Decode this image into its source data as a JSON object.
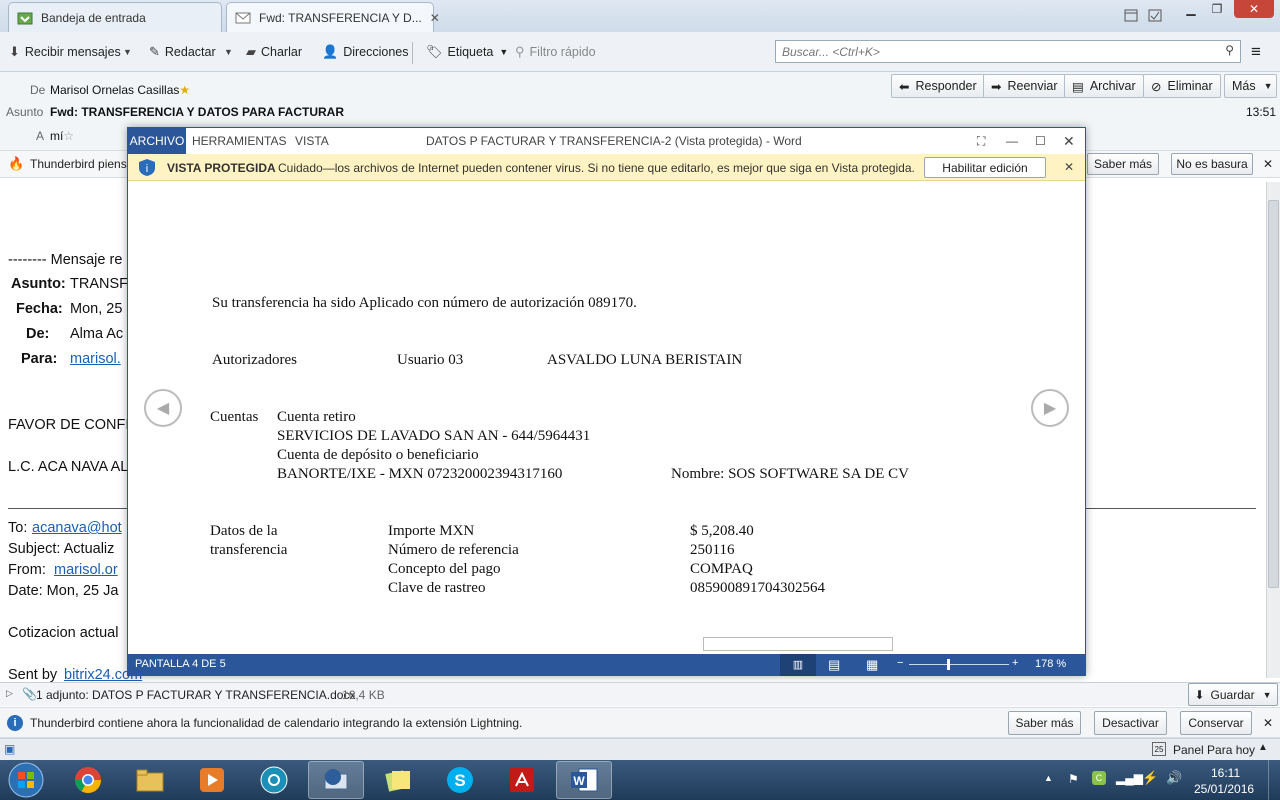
{
  "tabs": [
    {
      "label": "Bandeja de entrada"
    },
    {
      "label": "Fwd: TRANSFERENCIA Y D..."
    }
  ],
  "toolbar": {
    "receive": "Recibir mensajes",
    "compose": "Redactar",
    "chat": "Charlar",
    "addresses": "Direcciones",
    "tag": "Etiqueta",
    "quickfilter": "Filtro rápido",
    "search_placeholder": "Buscar... <Ctrl+K>"
  },
  "header": {
    "from_label": "De",
    "from_value": "Marisol Ornelas Casillas",
    "subject_label": "Asunto",
    "subject_value": "Fwd: TRANSFERENCIA Y DATOS PARA FACTURAR",
    "to_label": "A",
    "to_value": "mí",
    "time": "13:51",
    "buttons": {
      "reply": "Responder",
      "forward": "Reenviar",
      "archive": "Archivar",
      "delete": "Eliminar",
      "more": "Más"
    }
  },
  "junkbar": {
    "text": "Thunderbird piens",
    "learn_more": "Saber más",
    "not_junk": "No es basura"
  },
  "email": {
    "fwd_header": "-------- Mensaje re",
    "asunto_label": "Asunto:",
    "asunto_value": "TRANSF",
    "fecha_label": "Fecha:",
    "fecha_value": "Mon, 25",
    "de_label": "De:",
    "de_value": "Alma Ac",
    "para_label": "Para:",
    "para_value": "marisol.",
    "favor": "FAVOR DE CONFI",
    "lc": "L.C. ACA NAVA AL",
    "to_label": "To:",
    "to_value": "acanava@hot",
    "subject_line": "Subject: Actualiz",
    "from_label": "From:",
    "from_value": "marisol.or",
    "date_line": "Date: Mon, 25 Ja",
    "cotizacion": "Cotizacion actual",
    "sent_by": "Sent by",
    "sent_link": "bitrix24.com"
  },
  "word": {
    "menu": {
      "file": "ARCHIVO",
      "tools": "HERRAMIENTAS",
      "view": "VISTA"
    },
    "title": "DATOS P FACTURAR  Y TRANSFERENCIA-2 (Vista protegida) - Word",
    "protected_label": "VISTA PROTEGIDA",
    "protected_msg": "Cuidado—los archivos de Internet pueden contener virus. Si no tiene que editarlo, es mejor que siga en Vista protegida.",
    "enable_edit": "Habilitar edición",
    "status_page": "PANTALLA 4 DE 5",
    "zoom": "178 %",
    "zoom_level_percent": 178
  },
  "document": {
    "line1": "Su transferencia ha sido Aplicado con número de autorización 089170.",
    "autorizadores_label": "Autorizadores",
    "usuario": "Usuario 03",
    "nombre_aut": "ASVALDO LUNA BERISTAIN",
    "cuentas_label": "Cuentas",
    "cuenta_retiro_label": "Cuenta retiro",
    "cuenta_retiro_value": "SERVICIOS DE LAVADO SAN AN - 644/5964431",
    "cuenta_dep_label": "Cuenta de depósito o beneficiario",
    "cuenta_dep_value": "BANORTE/IXE - MXN 072320002394317160",
    "beneficiario": "Nombre: SOS SOFTWARE SA DE CV",
    "datos_label_1": "Datos de la",
    "datos_label_2": "transferencia",
    "rows": [
      {
        "label": "Importe MXN",
        "value": "$ 5,208.40"
      },
      {
        "label": "Número de referencia",
        "value": "250116"
      },
      {
        "label": "Concepto del pago",
        "value": "COMPAQ"
      },
      {
        "label": "Clave de rastreo",
        "value": "085900891704302564"
      }
    ]
  },
  "attachment": {
    "text": "1 adjunto: DATOS P FACTURAR Y TRANSFERENCIA.docx",
    "size": "16,4 KB",
    "save": "Guardar"
  },
  "lightning": {
    "text": "Thunderbird contiene ahora la funcionalidad de calendario integrando la extensión Lightning.",
    "learn_more": "Saber más",
    "deactivate": "Desactivar",
    "keep": "Conservar"
  },
  "statusbar": {
    "today_panel": "Panel Para hoy",
    "day": "25"
  },
  "taskbar": {
    "time": "16:11",
    "date": "25/01/2016"
  }
}
